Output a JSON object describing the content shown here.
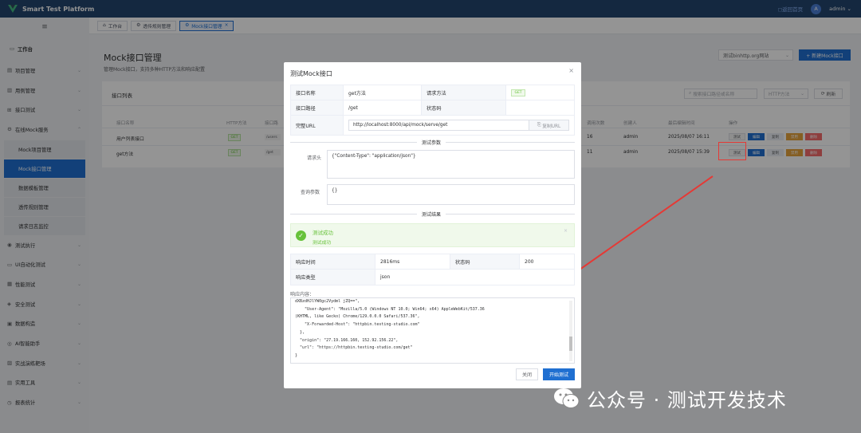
{
  "app": {
    "title": "Smart Test Platform",
    "home_link": "◻返回首页",
    "avatar": "A",
    "user": "admin"
  },
  "sidebar": {
    "home": "工作台",
    "items": [
      {
        "label": "项目管理"
      },
      {
        "label": "用例管理"
      },
      {
        "label": "接口测试"
      },
      {
        "label": "在线Mock服务"
      }
    ],
    "mock_sub": [
      "Mock项目管理",
      "Mock接口管理",
      "数据模板管理",
      "透传规则管理",
      "请求日志监控"
    ],
    "items2": [
      {
        "label": "测试执行"
      },
      {
        "label": "UI自动化测试"
      },
      {
        "label": "性能测试"
      },
      {
        "label": "安全测试"
      },
      {
        "label": "数据构造"
      },
      {
        "label": "AI智能助手"
      },
      {
        "label": "实战演练靶场"
      },
      {
        "label": "实用工具"
      },
      {
        "label": "报表统计"
      }
    ]
  },
  "tabs": [
    "工作台",
    "透传规则管理",
    "Mock接口管理"
  ],
  "page": {
    "title": "Mock接口管理",
    "subtitle": "管理Mock接口，支持多种HTTP方法和响应配置",
    "env_select": "测试binhttp.org网站",
    "new_button": "+ 新建Mock接口"
  },
  "card": {
    "title": "接口列表",
    "search_placeholder": "搜索接口路径或名称",
    "method_placeholder": "HTTP方法",
    "refresh": "刷新",
    "headers": [
      "接口名称",
      "HTTP方法",
      "接口路",
      "调用次数",
      "创建人",
      "最后编辑时间",
      "操作"
    ],
    "rows": [
      {
        "name": "用户列表接口",
        "method": "GET",
        "path": "/users",
        "calls": "16",
        "creator": "admin",
        "time": "2025/08/07 16:11"
      },
      {
        "name": "get方法",
        "method": "GET",
        "path": "/get",
        "calls": "11",
        "creator": "admin",
        "time": "2025/08/07 15:39"
      }
    ],
    "actions": [
      "测试",
      "编辑",
      "复制",
      "禁用",
      "删除"
    ]
  },
  "modal": {
    "title": "测试Mock接口",
    "close": "×",
    "name_label": "接口名称",
    "name_value": "get方法",
    "method_label": "请求方法",
    "method_value": "GET",
    "path_label": "接口路径",
    "path_value": "/get",
    "status_label": "状态码",
    "status_value": "",
    "url_label": "完整URL",
    "url_value": "http://localhost:8000/api/mock/serve/get",
    "copy_url": "复制URL",
    "params_divider": "测试参数",
    "headers_label": "请求头",
    "headers_value": "{\"Content-Type\": \"application/json\"}",
    "query_label": "查询参数",
    "query_value": "{}",
    "result_divider": "测试结果",
    "success_title": "测试成功",
    "success_desc": "测试成功",
    "resp_time_label": "响应时间",
    "resp_time_value": "2816ms",
    "resp_status_label": "状态码",
    "resp_status_value": "200",
    "resp_type_label": "响应类型",
    "resp_type_value": "json",
    "resp_content_label": "响应内容：",
    "resp_lines": [
      "dXBzdHJlYW0gc2Vydml jZQ==\",",
      "    \"User-Agent\": \"Mozilla/5.0 (Windows NT 10.0; Win64; x64) AppleWebKit/537.36",
      "(KHTML, like Gecko) Chrome/129.0.0.0 Safari/537.36\",",
      "    \"X-Forwarded-Host\": \"httpbin.testing-studio.com\"",
      "  },",
      "  \"origin\": \"27.19.166.160, 152.92.156.22\",",
      "  \"url\": \"https://httpbin.testing-studio.com/get\"",
      "}"
    ],
    "close_button": "关闭",
    "start_button": "开始测试"
  },
  "watermark": "公众号 · 测试开发技术",
  "colors": {
    "primary": "#1f6fd1",
    "success": "#67c23a",
    "annotation": "#e53935",
    "header": "#24466e"
  }
}
